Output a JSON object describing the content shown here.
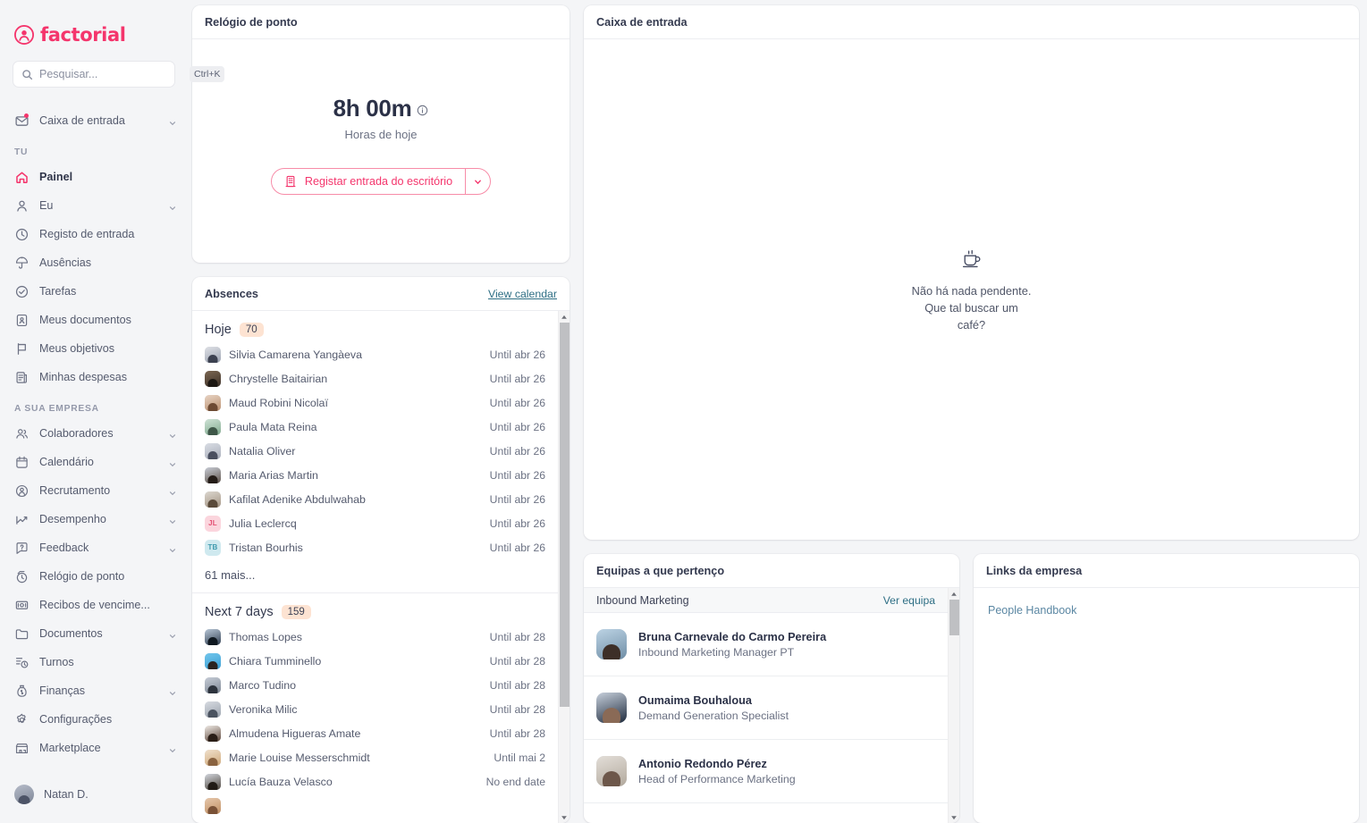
{
  "brand": {
    "name": "factorial",
    "logo_icon": "factorial-logo-icon",
    "color": "#f4356c"
  },
  "search": {
    "placeholder": "Pesquisar...",
    "shortcut": "Ctrl+K",
    "icon": "search-icon"
  },
  "sidebar": {
    "inbox": {
      "label": "Caixa de entrada",
      "icon": "mail-icon",
      "has_notification": true,
      "chevron": "chevron-down-icon"
    },
    "sections": [
      {
        "title": "TU",
        "items": [
          {
            "label": "Painel",
            "icon": "home-icon",
            "active": true,
            "chevron": false
          },
          {
            "label": "Eu",
            "icon": "user-icon",
            "active": false,
            "chevron": true
          },
          {
            "label": "Registo de entrada",
            "icon": "clock-icon",
            "active": false,
            "chevron": false
          },
          {
            "label": "Ausências",
            "icon": "umbrella-icon",
            "active": false,
            "chevron": false
          },
          {
            "label": "Tarefas",
            "icon": "check-circle-icon",
            "active": false,
            "chevron": false
          },
          {
            "label": "Meus documentos",
            "icon": "document-user-icon",
            "active": false,
            "chevron": false
          },
          {
            "label": "Meus objetivos",
            "icon": "flag-icon",
            "active": false,
            "chevron": false
          },
          {
            "label": "Minhas despesas",
            "icon": "receipt-icon",
            "active": false,
            "chevron": false
          }
        ]
      },
      {
        "title": "A SUA EMPRESA",
        "items": [
          {
            "label": "Colaboradores",
            "icon": "people-icon",
            "active": false,
            "chevron": true
          },
          {
            "label": "Calendário",
            "icon": "calendar-icon",
            "active": false,
            "chevron": true
          },
          {
            "label": "Recrutamento",
            "icon": "target-user-icon",
            "active": false,
            "chevron": true
          },
          {
            "label": "Desempenho",
            "icon": "trending-up-icon",
            "active": false,
            "chevron": true
          },
          {
            "label": "Feedback",
            "icon": "chat-question-icon",
            "active": false,
            "chevron": true
          },
          {
            "label": "Relógio de ponto",
            "icon": "stopwatch-icon",
            "active": false,
            "chevron": false
          },
          {
            "label": "Recibos de vencime...",
            "icon": "money-bill-icon",
            "active": false,
            "chevron": false
          },
          {
            "label": "Documentos",
            "icon": "folder-icon",
            "active": false,
            "chevron": true
          },
          {
            "label": "Turnos",
            "icon": "shifts-icon",
            "active": false,
            "chevron": false
          },
          {
            "label": "Finanças",
            "icon": "money-bag-icon",
            "active": false,
            "chevron": true
          },
          {
            "label": "Configurações",
            "icon": "gear-icon",
            "active": false,
            "chevron": false
          },
          {
            "label": "Marketplace",
            "icon": "store-icon",
            "active": false,
            "chevron": true
          }
        ]
      }
    ],
    "user": {
      "name": "Natan D.",
      "avatar": "user-avatar"
    }
  },
  "clock_card": {
    "title": "Relógio de ponto",
    "time": "8h 00m",
    "info_icon": "info-icon",
    "subtitle": "Horas de hoje",
    "button_label": "Registar entrada do escritório",
    "button_icon": "building-icon",
    "dropdown_icon": "chevron-down-icon",
    "accent_color": "#f4356c"
  },
  "absences_card": {
    "title": "Absences",
    "view_calendar_label": "View calendar",
    "more_label": "61 mais...",
    "groups": [
      {
        "name": "Hoje",
        "count": "70",
        "rows": [
          {
            "name": "Silvia Camarena Yangàeva",
            "until": "Until abr 26",
            "avatar_type": "photo",
            "c1": "#dfe1e6",
            "c2": "#9ba2b0",
            "c3": "#3c4150"
          },
          {
            "name": "Chrystelle Baitairian",
            "until": "Until abr 26",
            "avatar_type": "photo",
            "c1": "#7b6652",
            "c2": "#3c3027",
            "c3": "#1d1813"
          },
          {
            "name": "Maud Robini Nicolaï",
            "until": "Until abr 26",
            "avatar_type": "photo",
            "c1": "#e8d4c4",
            "c2": "#b98e6d",
            "c3": "#6d4a33"
          },
          {
            "name": "Paula Mata Reina",
            "until": "Until abr 26",
            "avatar_type": "photo",
            "c1": "#cfe3d6",
            "c2": "#7fa98d",
            "c3": "#3e5748"
          },
          {
            "name": "Natalia Oliver",
            "until": "Until abr 26",
            "avatar_type": "photo",
            "c1": "#d9dde4",
            "c2": "#a9aeba",
            "c3": "#4a4f5f"
          },
          {
            "name": "Maria Arias Martin",
            "until": "Until abr 26",
            "avatar_type": "photo",
            "c1": "#c8ccd5",
            "c2": "#5d5148",
            "c3": "#241c17"
          },
          {
            "name": "Kafilat Adenike Abdulwahab",
            "until": "Until abr 26",
            "avatar_type": "photo",
            "c1": "#dcd7cf",
            "c2": "#a39382",
            "c3": "#5a4a3a"
          },
          {
            "name": "Julia Leclercq",
            "until": "Until abr 26",
            "avatar_type": "initials",
            "initials": "JL",
            "bg": "#fbd5dd",
            "fg": "#e34f72"
          },
          {
            "name": "Tristan Bourhis",
            "until": "Until abr 26",
            "avatar_type": "initials",
            "initials": "TB",
            "bg": "#cfe9ef",
            "fg": "#3f9aae"
          }
        ]
      },
      {
        "name": "Next 7 days",
        "count": "159",
        "rows": [
          {
            "name": "Thomas Lopes",
            "until": "Until abr 28",
            "avatar_type": "photo",
            "c1": "#b7c6d6",
            "c2": "#2f3d4f",
            "c3": "#0f1820"
          },
          {
            "name": "Chiara Tumminello",
            "until": "Until abr 28",
            "avatar_type": "photo",
            "c1": "#72c6ec",
            "c2": "#3a9fd4",
            "c3": "#2b2420"
          },
          {
            "name": "Marco Tudino",
            "until": "Until abr 28",
            "avatar_type": "photo",
            "c1": "#c6ccd6",
            "c2": "#7d8794",
            "c3": "#2d333d"
          },
          {
            "name": "Veronika Milic",
            "until": "Until abr 28",
            "avatar_type": "photo",
            "c1": "#d7dbe1",
            "c2": "#9aa2ad",
            "c3": "#4b5360"
          },
          {
            "name": "Almudena Higueras Amate",
            "until": "Until abr 28",
            "avatar_type": "photo",
            "c1": "#efeae5",
            "c2": "#574034",
            "c3": "#2a1d16"
          },
          {
            "name": "Marie Louise Messerschmidt",
            "until": "Until mai 2",
            "avatar_type": "photo",
            "c1": "#f0e0cc",
            "c2": "#cfa878",
            "c3": "#8a6340"
          },
          {
            "name": "Lucía Bauza Velasco",
            "until": "No end date",
            "avatar_type": "photo",
            "c1": "#d2d6dd",
            "c2": "#4a4239",
            "c3": "#211b16"
          },
          {
            "name": "",
            "until": "",
            "avatar_type": "photo",
            "c1": "#e6c7ab",
            "c2": "#c08f63",
            "c3": "#7a5136"
          }
        ]
      }
    ],
    "scrollbar": {
      "up_icon": "scroll-up-arrow-icon",
      "down_icon": "scroll-down-arrow-icon"
    }
  },
  "inbox_card": {
    "title": "Caixa de entrada",
    "empty_icon": "coffee-cup-icon",
    "empty_line1": "Não há nada pendente.",
    "empty_line2": "Que tal buscar um",
    "empty_line3": "café?"
  },
  "teams_card": {
    "title": "Equipas a que pertenço",
    "team_name": "Inbound Marketing",
    "team_link": "Ver equipa",
    "members": [
      {
        "name": "Bruna Carnevale do Carmo Pereira",
        "role": "Inbound Marketing Manager PT",
        "c1": "#bcd3e4",
        "c2": "#6f8ea6",
        "c3": "#3d2f28"
      },
      {
        "name": "Oumaima Bouhaloua",
        "role": "Demand Generation Specialist",
        "c1": "#c6cfdb",
        "c2": "#202c3e",
        "c3": "#8a6a56"
      },
      {
        "name": "Antonio Redondo Pérez",
        "role": "Head of Performance Marketing",
        "c1": "#e3ded8",
        "c2": "#b2a99d",
        "c3": "#6d574a"
      }
    ],
    "scrollbar": {
      "up_icon": "scroll-up-arrow-icon",
      "down_icon": "scroll-down-arrow-icon"
    }
  },
  "links_card": {
    "title": "Links da empresa",
    "links": [
      {
        "label": "People Handbook"
      }
    ]
  }
}
